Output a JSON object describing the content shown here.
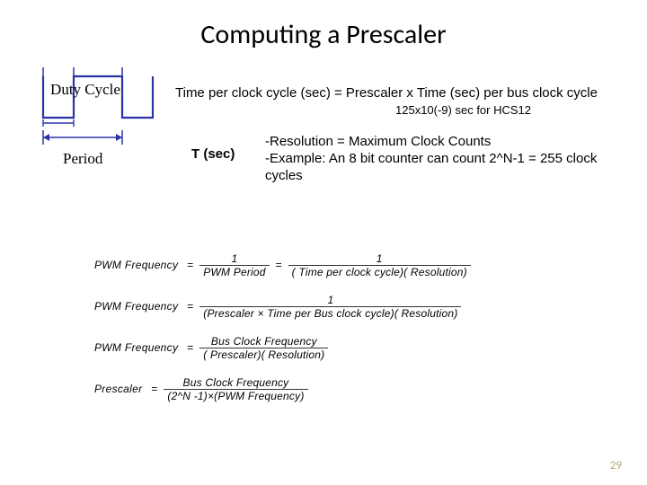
{
  "title": "Computing a Prescaler",
  "waveform": {
    "duty_cycle_label": "Duty Cycle",
    "period_label": "Period"
  },
  "formula_line": "Time per clock cycle (sec) = Prescaler x Time (sec) per bus clock cycle",
  "sub_note": "125x10(-9) sec for HCS12",
  "tsec": "T (sec)",
  "resolution": {
    "line1": "-Resolution = Maximum Clock Counts",
    "line2": "-Example: An 8 bit counter can count 2^N-1 = 255 clock cycles"
  },
  "eq": {
    "pwm_freq_label": "PWM Frequency",
    "prescaler_label": "Prescaler",
    "eq1_num1": "1",
    "eq1_den1": "PWM Period",
    "eq1_num2": "1",
    "eq1_den2": "( Time per clock cycle)( Resolution)",
    "eq2_num": "1",
    "eq2_den": "(Prescaler × Time per Bus clock cycle)( Resolution)",
    "eq3_num": "Bus Clock Frequency",
    "eq3_den": "( Prescaler)( Resolution)",
    "eq4_num": "Bus Clock Frequency",
    "eq4_den": "(2^N -1)×(PWM Frequency)"
  },
  "page_num": "29"
}
